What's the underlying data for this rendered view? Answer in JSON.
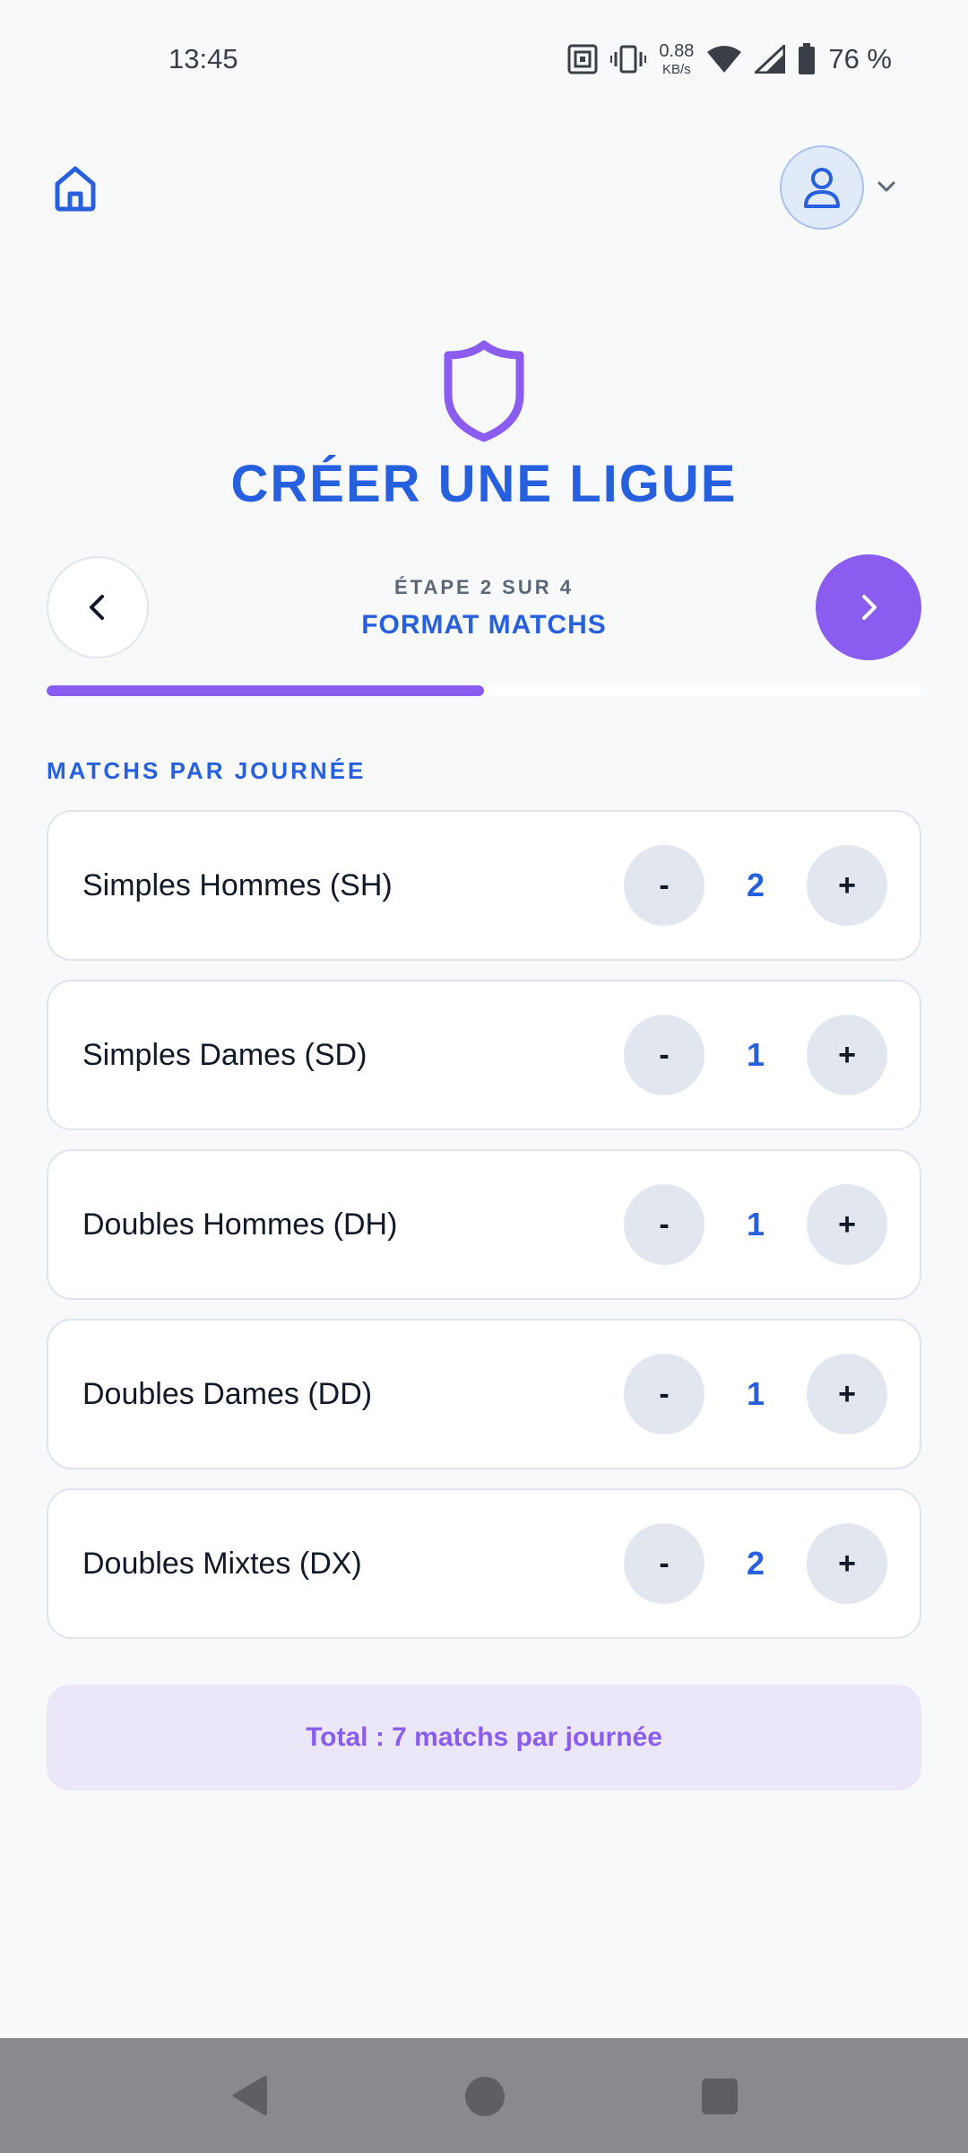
{
  "status_bar": {
    "time": "13:45",
    "net_speed_value": "0.88",
    "net_speed_unit": "KB/s",
    "battery": "76 %",
    "icons": [
      "nfc-icon",
      "vibrate-icon",
      "wifi-icon",
      "signal-icon",
      "battery-icon"
    ]
  },
  "header": {
    "home_icon": "home-icon",
    "avatar_icon": "user-icon",
    "menu_icon": "chevron-down-icon"
  },
  "hero": {
    "icon": "shield-icon",
    "title": "CRÉER UNE LIGUE"
  },
  "stepper": {
    "step_label": "ÉTAPE 2 SUR 4",
    "step_name": "FORMAT MATCHS",
    "back_icon": "chevron-left-icon",
    "next_icon": "chevron-right-icon",
    "progress_fraction": 0.5
  },
  "section": {
    "label": "MATCHS PAR JOURNÉE"
  },
  "matches": [
    {
      "label": "Simples Hommes (SH)",
      "count": "2",
      "minus": "-",
      "plus": "+"
    },
    {
      "label": "Simples Dames (SD)",
      "count": "1",
      "minus": "-",
      "plus": "+"
    },
    {
      "label": "Doubles Hommes (DH)",
      "count": "1",
      "minus": "-",
      "plus": "+"
    },
    {
      "label": "Doubles Dames (DD)",
      "count": "1",
      "minus": "-",
      "plus": "+"
    },
    {
      "label": "Doubles Mixtes (DX)",
      "count": "2",
      "minus": "-",
      "plus": "+"
    }
  ],
  "total": {
    "text": "Total : 7 matchs par journée"
  },
  "colors": {
    "primary_blue": "#2760de",
    "accent_purple": "#8b5cf0",
    "background": "#f8f9fb"
  }
}
